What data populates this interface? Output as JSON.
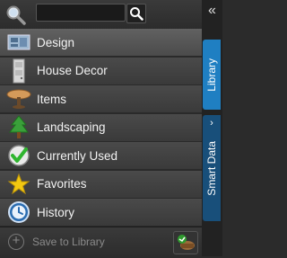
{
  "search": {
    "value": "",
    "placeholder": ""
  },
  "categories": [
    {
      "label": "Design",
      "icon": "design-icon",
      "selected": true
    },
    {
      "label": "House Decor",
      "icon": "house-decor-icon",
      "selected": false
    },
    {
      "label": "Items",
      "icon": "items-icon",
      "selected": false
    },
    {
      "label": "Landscaping",
      "icon": "landscaping-icon",
      "selected": false
    },
    {
      "label": "Currently Used",
      "icon": "currently-used-icon",
      "selected": false
    },
    {
      "label": "Favorites",
      "icon": "favorites-icon",
      "selected": false
    },
    {
      "label": "History",
      "icon": "history-icon",
      "selected": false
    }
  ],
  "footer": {
    "save_label": "Save to Library"
  },
  "rail": {
    "tab_library": "Library",
    "tab_smart_data": "Smart Data",
    "collapse_glyph": "«",
    "smart_chevron": "›"
  }
}
